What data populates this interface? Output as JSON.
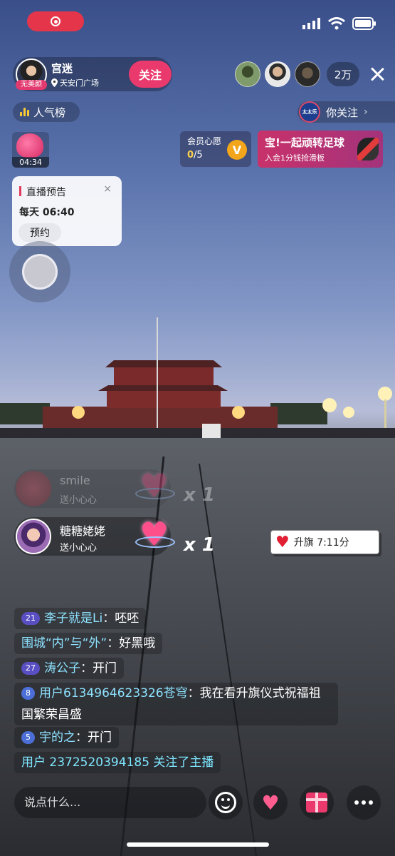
{
  "status_bar": {
    "rec_icon": "record-icon"
  },
  "anchor": {
    "name": "宫迷",
    "tag": "无美颜",
    "location": "天安门广场",
    "location_icon": "location-pin-icon",
    "follow_label": "关注"
  },
  "viewers": {
    "count": "2万"
  },
  "rank": {
    "label": "人气榜"
  },
  "follow_hint": {
    "logo_text": "太太乐",
    "label": "你关注"
  },
  "gift_timer": {
    "time": "04:34"
  },
  "member": {
    "title": "会员心愿",
    "current": "0",
    "total": "/5",
    "badge": "V"
  },
  "promo": {
    "title": "宝!一起顽转足球",
    "subtitle": "入会1分钱抢滑板"
  },
  "notice": {
    "title": "直播预告",
    "close": "×",
    "time": "每天 06:40",
    "button": "预约"
  },
  "gift_stream": [
    {
      "name": "smile",
      "gift": "送小心心",
      "count": "x 1"
    },
    {
      "name": "糖糖姥姥",
      "gift": "送小心心",
      "count": "x 1"
    }
  ],
  "raise_flag": {
    "label": "升旗 7:11分"
  },
  "chat": [
    {
      "level": "21",
      "user": "李子就是Li",
      "text": "呸呸"
    },
    {
      "level": "",
      "user": "围城“内”与“外”",
      "text": "好黑哦"
    },
    {
      "level": "27",
      "user": "涛公子",
      "text": "开门"
    },
    {
      "level": "8",
      "user": "用户6134964623326苍穹",
      "text": "我在看升旗仪式祝福祖国繁荣昌盛"
    },
    {
      "level": "5",
      "user": "宇的之",
      "text": "开门"
    }
  ],
  "system_message": "用户 2372520394185 关注了主播",
  "input": {
    "placeholder": "说点什么..."
  }
}
